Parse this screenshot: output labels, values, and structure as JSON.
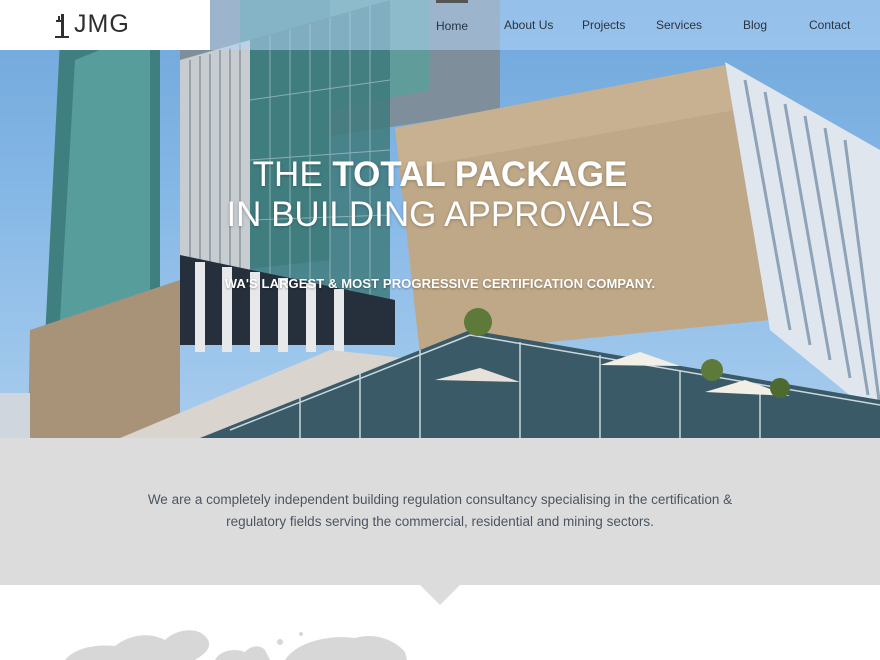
{
  "brand": {
    "name": "JMG",
    "logo_icon": "building-crane-icon"
  },
  "nav": {
    "items": [
      {
        "label": "Home",
        "active": true
      },
      {
        "label": "About Us",
        "active": false
      },
      {
        "label": "Projects",
        "active": false
      },
      {
        "label": "Services",
        "active": false
      },
      {
        "label": "Blog",
        "active": false
      },
      {
        "label": "Contact",
        "active": false
      }
    ]
  },
  "hero": {
    "title_line1_light": "THE ",
    "title_line1_bold": "TOTAL PACKAGE",
    "title_line2": "IN BUILDING APPROVALS",
    "subtitle": "WA'S LARGEST & MOST PROGRESSIVE CERTIFICATION COMPANY.",
    "image": "modern-glass-building-photo"
  },
  "intro": {
    "text": "We are a completely independent building regulation consultancy specialising in the certification & regulatory fields serving the commercial, residential and mining sectors."
  },
  "lower": {
    "image": "world-map-graphic"
  },
  "colors": {
    "intro_bg": "#dddcdd",
    "nav_overlay": "#b4d6f5",
    "intro_text": "#4a5560",
    "hero_text": "#ffffff"
  }
}
